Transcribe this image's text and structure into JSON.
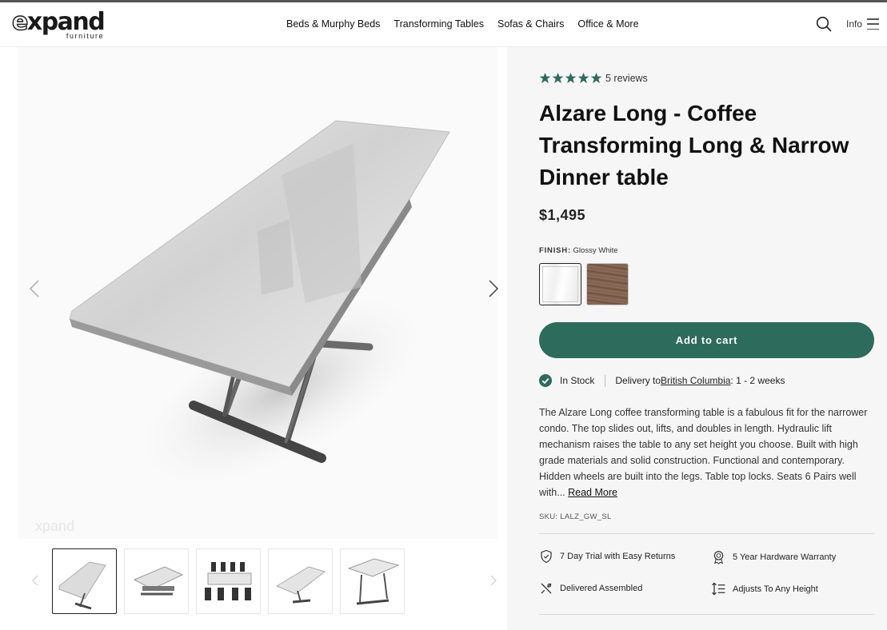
{
  "header": {
    "logo_word": "expand",
    "logo_sub": "furniture",
    "nav": [
      "Beds & Murphy Beds",
      "Transforming Tables",
      "Sofas & Chairs",
      "Office & More"
    ],
    "info_label": "Info"
  },
  "gallery": {
    "watermark": "xpand",
    "thumbnails": [
      "thumb-glossy-top",
      "thumb-coffee-height",
      "thumb-dining-chairs",
      "thumb-angled",
      "thumb-raised"
    ]
  },
  "product": {
    "rating": 5,
    "reviews_label": "5 reviews",
    "title": "Alzare Long - Coffee Transforming Long & Narrow Dinner table",
    "price": "$1,495",
    "finish_label": "FINISH:",
    "finish_value": "Glossy White",
    "swatches": [
      "Glossy White",
      "Walnut"
    ],
    "add_to_cart": "Add to cart",
    "stock_label": "In Stock",
    "delivery_prefix": "Delivery to ",
    "delivery_region": "British Columbia",
    "delivery_suffix": ": 1 - 2 weeks",
    "description": "The Alzare Long coffee transforming table is a fabulous fit for the narrower condo. The top slides out, lifts, and doubles in length. Hydraulic lift mechanism raises the table to any set height you choose. Built with high grade materials and solid construction. Functional and contemporary. Hidden wheels are built into the legs. Table top locks. Seats 6 Pairs well with... ",
    "read_more": "Read More",
    "sku": "SKU: LALZ_GW_SL",
    "features": [
      {
        "icon": "shield-check-icon",
        "label": "7 Day Trial with Easy Returns"
      },
      {
        "icon": "award-badge-icon",
        "label": "5 Year Hardware Warranty"
      },
      {
        "icon": "tools-icon",
        "label": "Delivered Assembled"
      },
      {
        "icon": "height-adjust-icon",
        "label": "Adjusts To Any Height"
      }
    ]
  },
  "colors": {
    "accent": "#2d6b5c",
    "panel_bg": "#f6f6f6"
  }
}
